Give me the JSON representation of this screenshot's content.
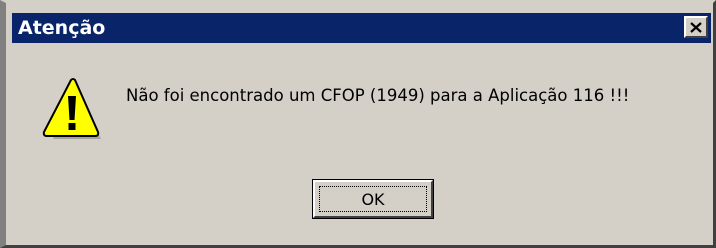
{
  "window": {
    "title": "Atenção",
    "close_glyph": "close-icon"
  },
  "content": {
    "icon": "warning-icon",
    "message": "Não foi encontrado um CFOP (1949) para a Aplicação 116 !!!"
  },
  "buttons": {
    "ok_label": "OK"
  },
  "colors": {
    "titlebar": "#0a246a",
    "dialog_face": "#d4d0c8",
    "warning_yellow": "#ffff00"
  }
}
